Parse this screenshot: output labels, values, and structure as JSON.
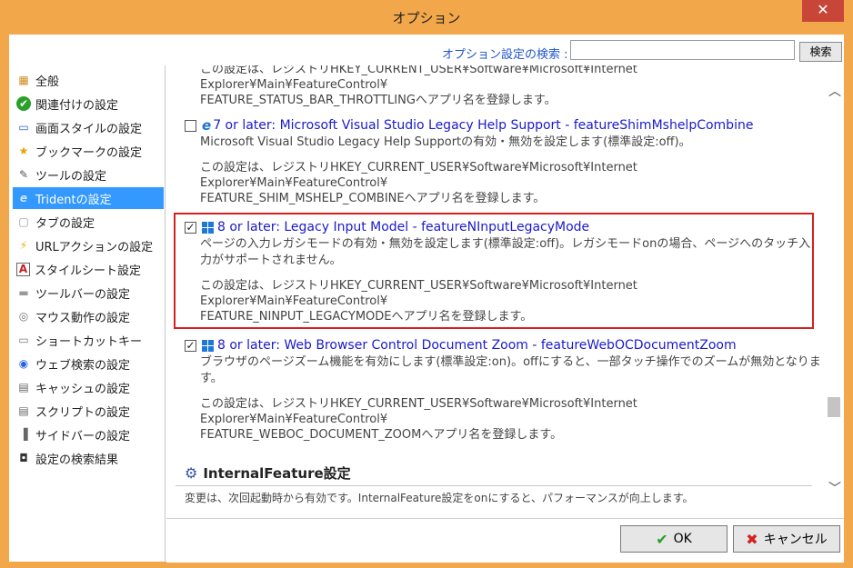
{
  "window": {
    "title": "オプション",
    "close_glyph": "✕"
  },
  "search": {
    "label": "オプション設定の検索 :",
    "value": "",
    "button": "検索"
  },
  "sidebar": {
    "items": [
      {
        "label": "全般",
        "icon": "general-icon",
        "glyph": "▦"
      },
      {
        "label": "関連付けの設定",
        "icon": "association-icon",
        "glyph": "✔"
      },
      {
        "label": "画面スタイルの設定",
        "icon": "screen-style-icon",
        "glyph": "▭"
      },
      {
        "label": "ブックマークの設定",
        "icon": "bookmark-star-icon",
        "glyph": "★"
      },
      {
        "label": "ツールの設定",
        "icon": "tool-icon",
        "glyph": "✎"
      },
      {
        "label": "Tridentの設定",
        "icon": "ie-icon",
        "glyph": "e"
      },
      {
        "label": "タブの設定",
        "icon": "tab-icon",
        "glyph": "▢"
      },
      {
        "label": "URLアクションの設定",
        "icon": "lightning-icon",
        "glyph": "⚡"
      },
      {
        "label": "スタイルシート設定",
        "icon": "stylesheet-icon",
        "glyph": "A"
      },
      {
        "label": "ツールバーの設定",
        "icon": "toolbar-icon",
        "glyph": "▬"
      },
      {
        "label": "マウス動作の設定",
        "icon": "mouse-icon",
        "glyph": "◎"
      },
      {
        "label": "ショートカットキー",
        "icon": "keyboard-icon",
        "glyph": "▭"
      },
      {
        "label": "ウェブ検索の設定",
        "icon": "web-search-icon",
        "glyph": "◉"
      },
      {
        "label": "キャッシュの設定",
        "icon": "cache-icon",
        "glyph": "▤"
      },
      {
        "label": "スクリプトの設定",
        "icon": "script-icon",
        "glyph": "▤"
      },
      {
        "label": "サイドバーの設定",
        "icon": "sidebar-icon",
        "glyph": "▐"
      },
      {
        "label": "設定の検索結果",
        "icon": "binoculars-icon",
        "glyph": "◘"
      }
    ]
  },
  "content": {
    "top_fragment": {
      "lines": [
        "この設定は、レジストリHKEY_CURRENT_USER¥Software¥Microsoft¥Internet",
        "Explorer¥Main¥FeatureControl¥",
        "FEATURE_STATUS_BAR_THROTTLINGへアプリ名を登録します。"
      ]
    },
    "entries": [
      {
        "checked": false,
        "check_glyph": "",
        "title": "7 or later: Microsoft Visual Studio Legacy Help Support - featureShimMshelpCombine",
        "desc": "Microsoft Visual Studio Legacy Help Supportの有効・無効を設定します(標準設定:off)。",
        "reg": [
          "この設定は、レジストリHKEY_CURRENT_USER¥Software¥Microsoft¥Internet",
          "Explorer¥Main¥FeatureControl¥",
          "FEATURE_SHIM_MSHELP_COMBINEへアプリ名を登録します。"
        ]
      },
      {
        "checked": true,
        "check_glyph": "✓",
        "title": "8 or later: Legacy Input Model - featureNInputLegacyMode",
        "desc": "ページの入力レガシモードの有効・無効を設定します(標準設定:off)。レガシモードonの場合、ページへのタッチ入力がサポートされません。",
        "reg": [
          "この設定は、レジストリHKEY_CURRENT_USER¥Software¥Microsoft¥Internet",
          "Explorer¥Main¥FeatureControl¥",
          "FEATURE_NINPUT_LEGACYMODEへアプリ名を登録します。"
        ]
      },
      {
        "checked": true,
        "check_glyph": "✓",
        "title": "8 or later: Web Browser Control Document Zoom - featureWebOCDocumentZoom",
        "desc": "ブラウザのページズーム機能を有効にします(標準設定:on)。offにすると、一部タッチ操作でのズームが無効となります。",
        "reg": [
          "この設定は、レジストリHKEY_CURRENT_USER¥Software¥Microsoft¥Internet",
          "Explorer¥Main¥FeatureControl¥",
          "FEATURE_WEBOC_DOCUMENT_ZOOMへアプリ名を登録します。"
        ]
      }
    ],
    "section": {
      "title": "InternalFeature設定",
      "desc": "変更は、次回起動時から有効です。InternalFeature設定をonにすると、パフォーマンスが向上します。"
    }
  },
  "buttons": {
    "ok": "OK",
    "cancel": "キャンセル"
  },
  "colors": {
    "titlebar": "#f2a84a",
    "selected": "#3399ff",
    "link": "#1a1acc",
    "highlight_border": "#d42020"
  }
}
